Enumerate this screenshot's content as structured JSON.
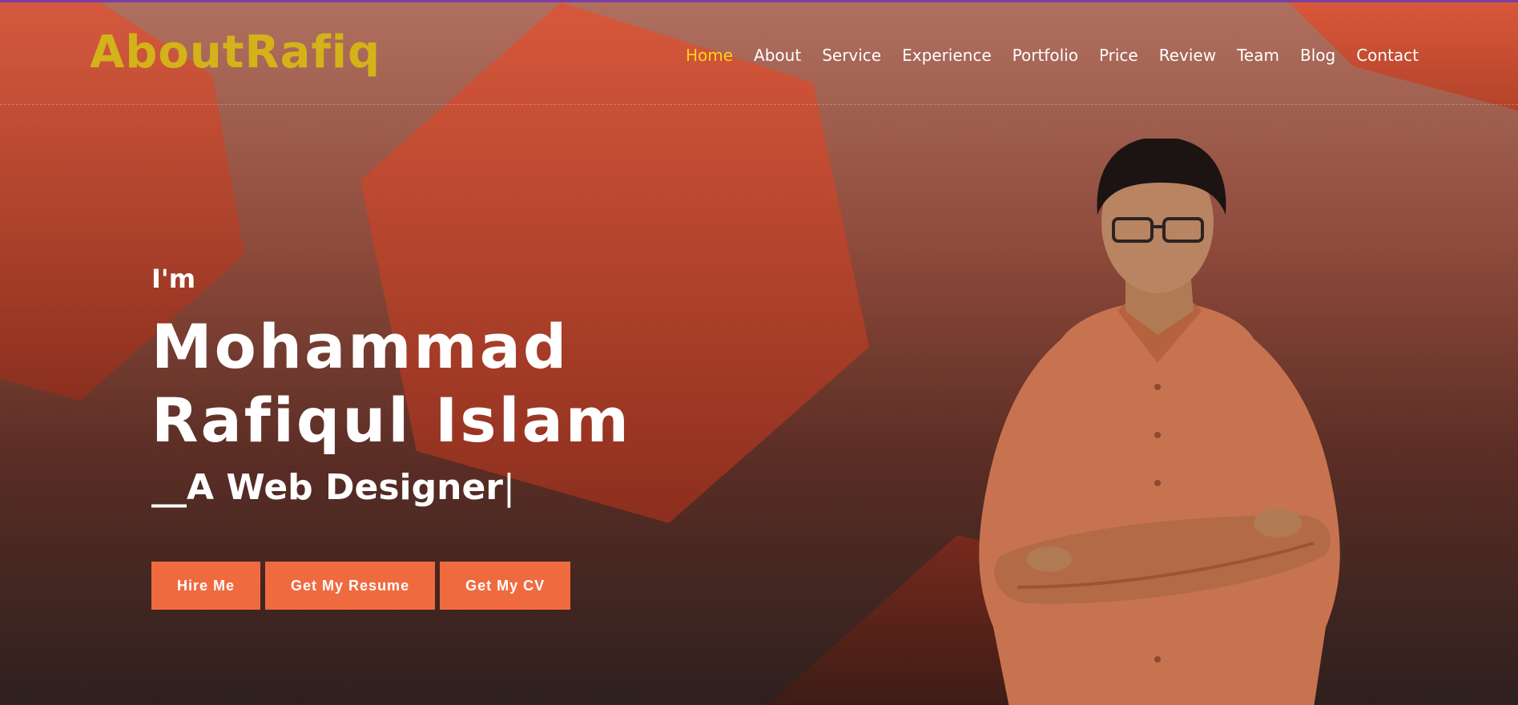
{
  "header": {
    "logo": "AboutRafiq",
    "nav": [
      {
        "label": "Home",
        "active": true
      },
      {
        "label": "About"
      },
      {
        "label": "Service"
      },
      {
        "label": "Experience"
      },
      {
        "label": "Portfolio"
      },
      {
        "label": "Price"
      },
      {
        "label": "Review"
      },
      {
        "label": "Team"
      },
      {
        "label": "Blog"
      },
      {
        "label": "Contact"
      }
    ]
  },
  "hero": {
    "intro": "I'm",
    "name_line1": "Mohammad",
    "name_line2": "Rafiqul Islam",
    "role": "__A Web Designer",
    "cursor": "|",
    "buttons": {
      "hire": "Hire Me",
      "resume": "Get My Resume",
      "cv": "Get My CV"
    }
  },
  "colors": {
    "logo": "#d4b21a",
    "nav_active": "#ffd21a",
    "button": "#f06a40",
    "shape": "#d9573a"
  }
}
